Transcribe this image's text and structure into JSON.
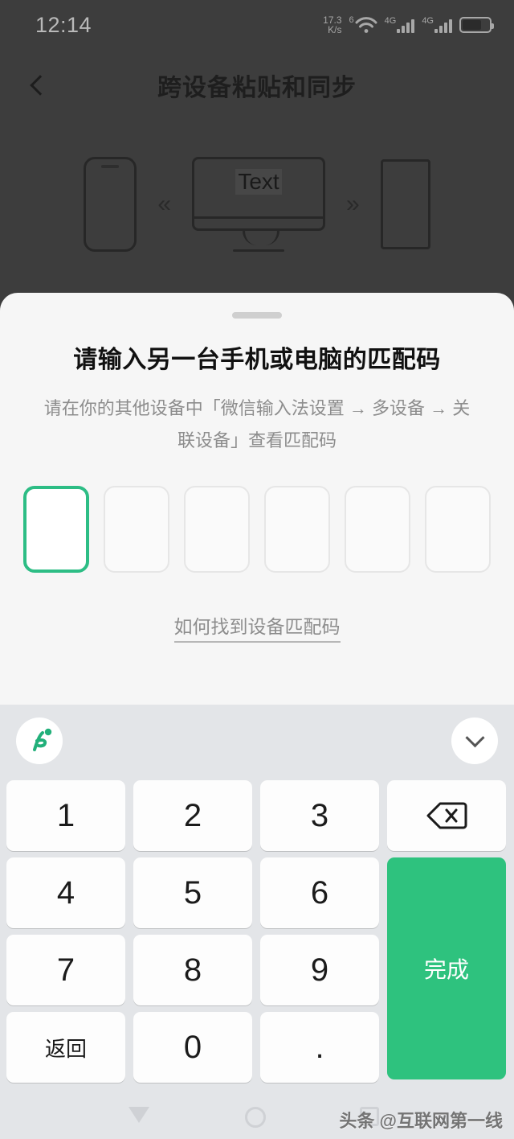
{
  "status_bar": {
    "time": "12:14",
    "net_speed_value": "17.3",
    "net_speed_unit": "K/s",
    "wifi_generation": "6",
    "sim1_label": "4G",
    "sim2_label": "4G"
  },
  "header": {
    "title": "跨设备粘贴和同步",
    "back_icon": "chevron-left-icon"
  },
  "illustration": {
    "monitor_text": "Text",
    "arrow_left": "«",
    "arrow_right": "»"
  },
  "sheet": {
    "title": "请输入另一台手机或电脑的匹配码",
    "description": "请在你的其他设备中「微信输入法设置 → 多设备 → 关联设备」查看匹配码",
    "help_link": "如何找到设备匹配码",
    "otp": {
      "length": 6,
      "active_index": 0,
      "values": [
        "",
        "",
        "",
        "",
        "",
        ""
      ],
      "active_color": "#2dbd85"
    }
  },
  "keyboard": {
    "logo_icon": "wechat-input-logo-icon",
    "collapse_icon": "chevron-down-icon",
    "accent_color": "#2ec27e",
    "keys": [
      {
        "label": "1",
        "type": "digit"
      },
      {
        "label": "2",
        "type": "digit"
      },
      {
        "label": "3",
        "type": "digit"
      },
      {
        "label": "",
        "type": "backspace",
        "icon": "backspace-icon"
      },
      {
        "label": "4",
        "type": "digit"
      },
      {
        "label": "5",
        "type": "digit"
      },
      {
        "label": "6",
        "type": "digit"
      },
      {
        "label": "7",
        "type": "digit"
      },
      {
        "label": "8",
        "type": "digit"
      },
      {
        "label": "9",
        "type": "digit"
      },
      {
        "label": "返回",
        "type": "action"
      },
      {
        "label": "0",
        "type": "digit"
      },
      {
        "label": ".",
        "type": "digit"
      },
      {
        "label": "完成",
        "type": "confirm"
      }
    ]
  },
  "system_nav": {
    "back_icon": "triangle-back-icon",
    "home_icon": "circle-home-icon",
    "recents_icon": "square-recents-icon"
  },
  "watermark": {
    "text": "头条 @互联网第一线"
  }
}
